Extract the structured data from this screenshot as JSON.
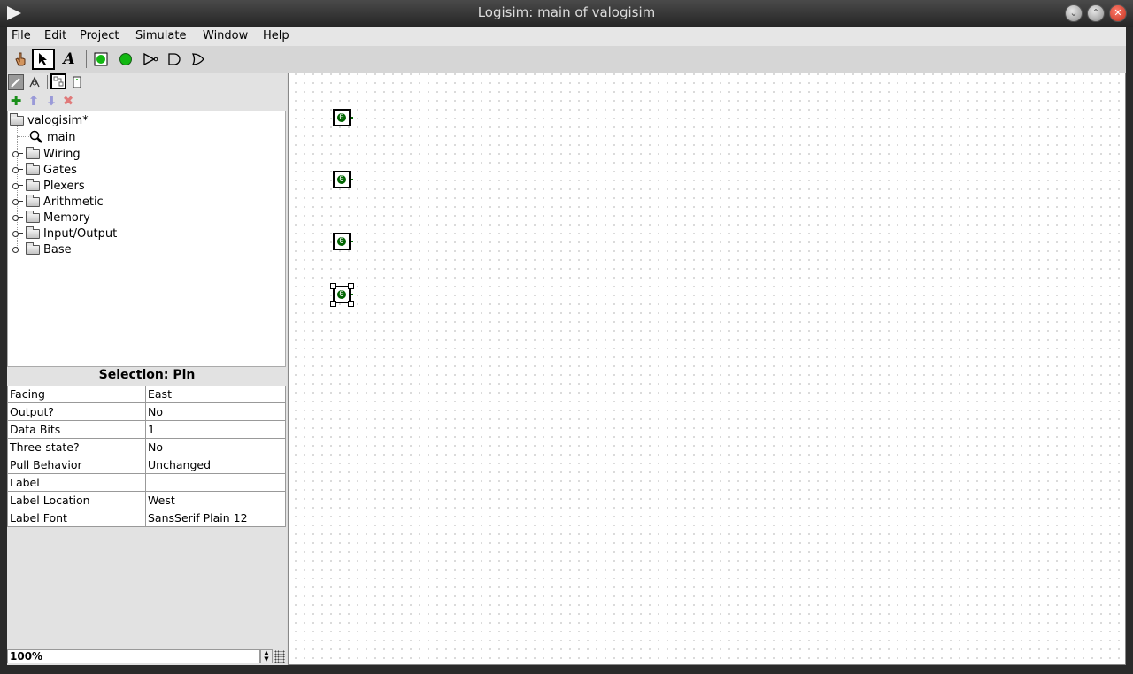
{
  "window": {
    "title": "Logisim: main of valogisim",
    "controls": [
      "minimize-icon",
      "maximize-icon",
      "close-icon"
    ]
  },
  "menubar": [
    "File",
    "Edit",
    "Project",
    "Simulate",
    "Window",
    "Help"
  ],
  "toolbar": {
    "tools": [
      "poke-tool-icon",
      "select-tool-icon",
      "text-tool-icon",
      "input-pin-icon",
      "output-pin-icon",
      "not-gate-icon",
      "and-gate-icon",
      "or-gate-icon"
    ],
    "active_tool": "select-tool-icon"
  },
  "explorer": {
    "tools": [
      "show-project-toolbox-icon",
      "show-simulation-tree-icon",
      "edit-layout-icon",
      "edit-appearance-icon"
    ],
    "circuit_tools": [
      "add-circuit-icon",
      "move-up-icon",
      "move-down-icon",
      "remove-circuit-icon"
    ],
    "project": "valogisim*",
    "circuit": "main",
    "libraries": [
      "Wiring",
      "Gates",
      "Plexers",
      "Arithmetic",
      "Memory",
      "Input/Output",
      "Base"
    ]
  },
  "selection": {
    "title": "Selection: Pin",
    "properties": [
      {
        "key": "Facing",
        "value": "East"
      },
      {
        "key": "Output?",
        "value": "No"
      },
      {
        "key": "Data Bits",
        "value": "1"
      },
      {
        "key": "Three-state?",
        "value": "No"
      },
      {
        "key": "Pull Behavior",
        "value": "Unchanged"
      },
      {
        "key": "Label",
        "value": ""
      },
      {
        "key": "Label Location",
        "value": "West"
      },
      {
        "key": "Label Font",
        "value": "SansSerif Plain 12"
      }
    ]
  },
  "zoom": "100%",
  "canvas": {
    "pins": [
      {
        "value": "0",
        "selected": false
      },
      {
        "value": "0",
        "selected": false
      },
      {
        "value": "0",
        "selected": false
      },
      {
        "value": "0",
        "selected": true
      }
    ],
    "pin_color": "#006400"
  }
}
